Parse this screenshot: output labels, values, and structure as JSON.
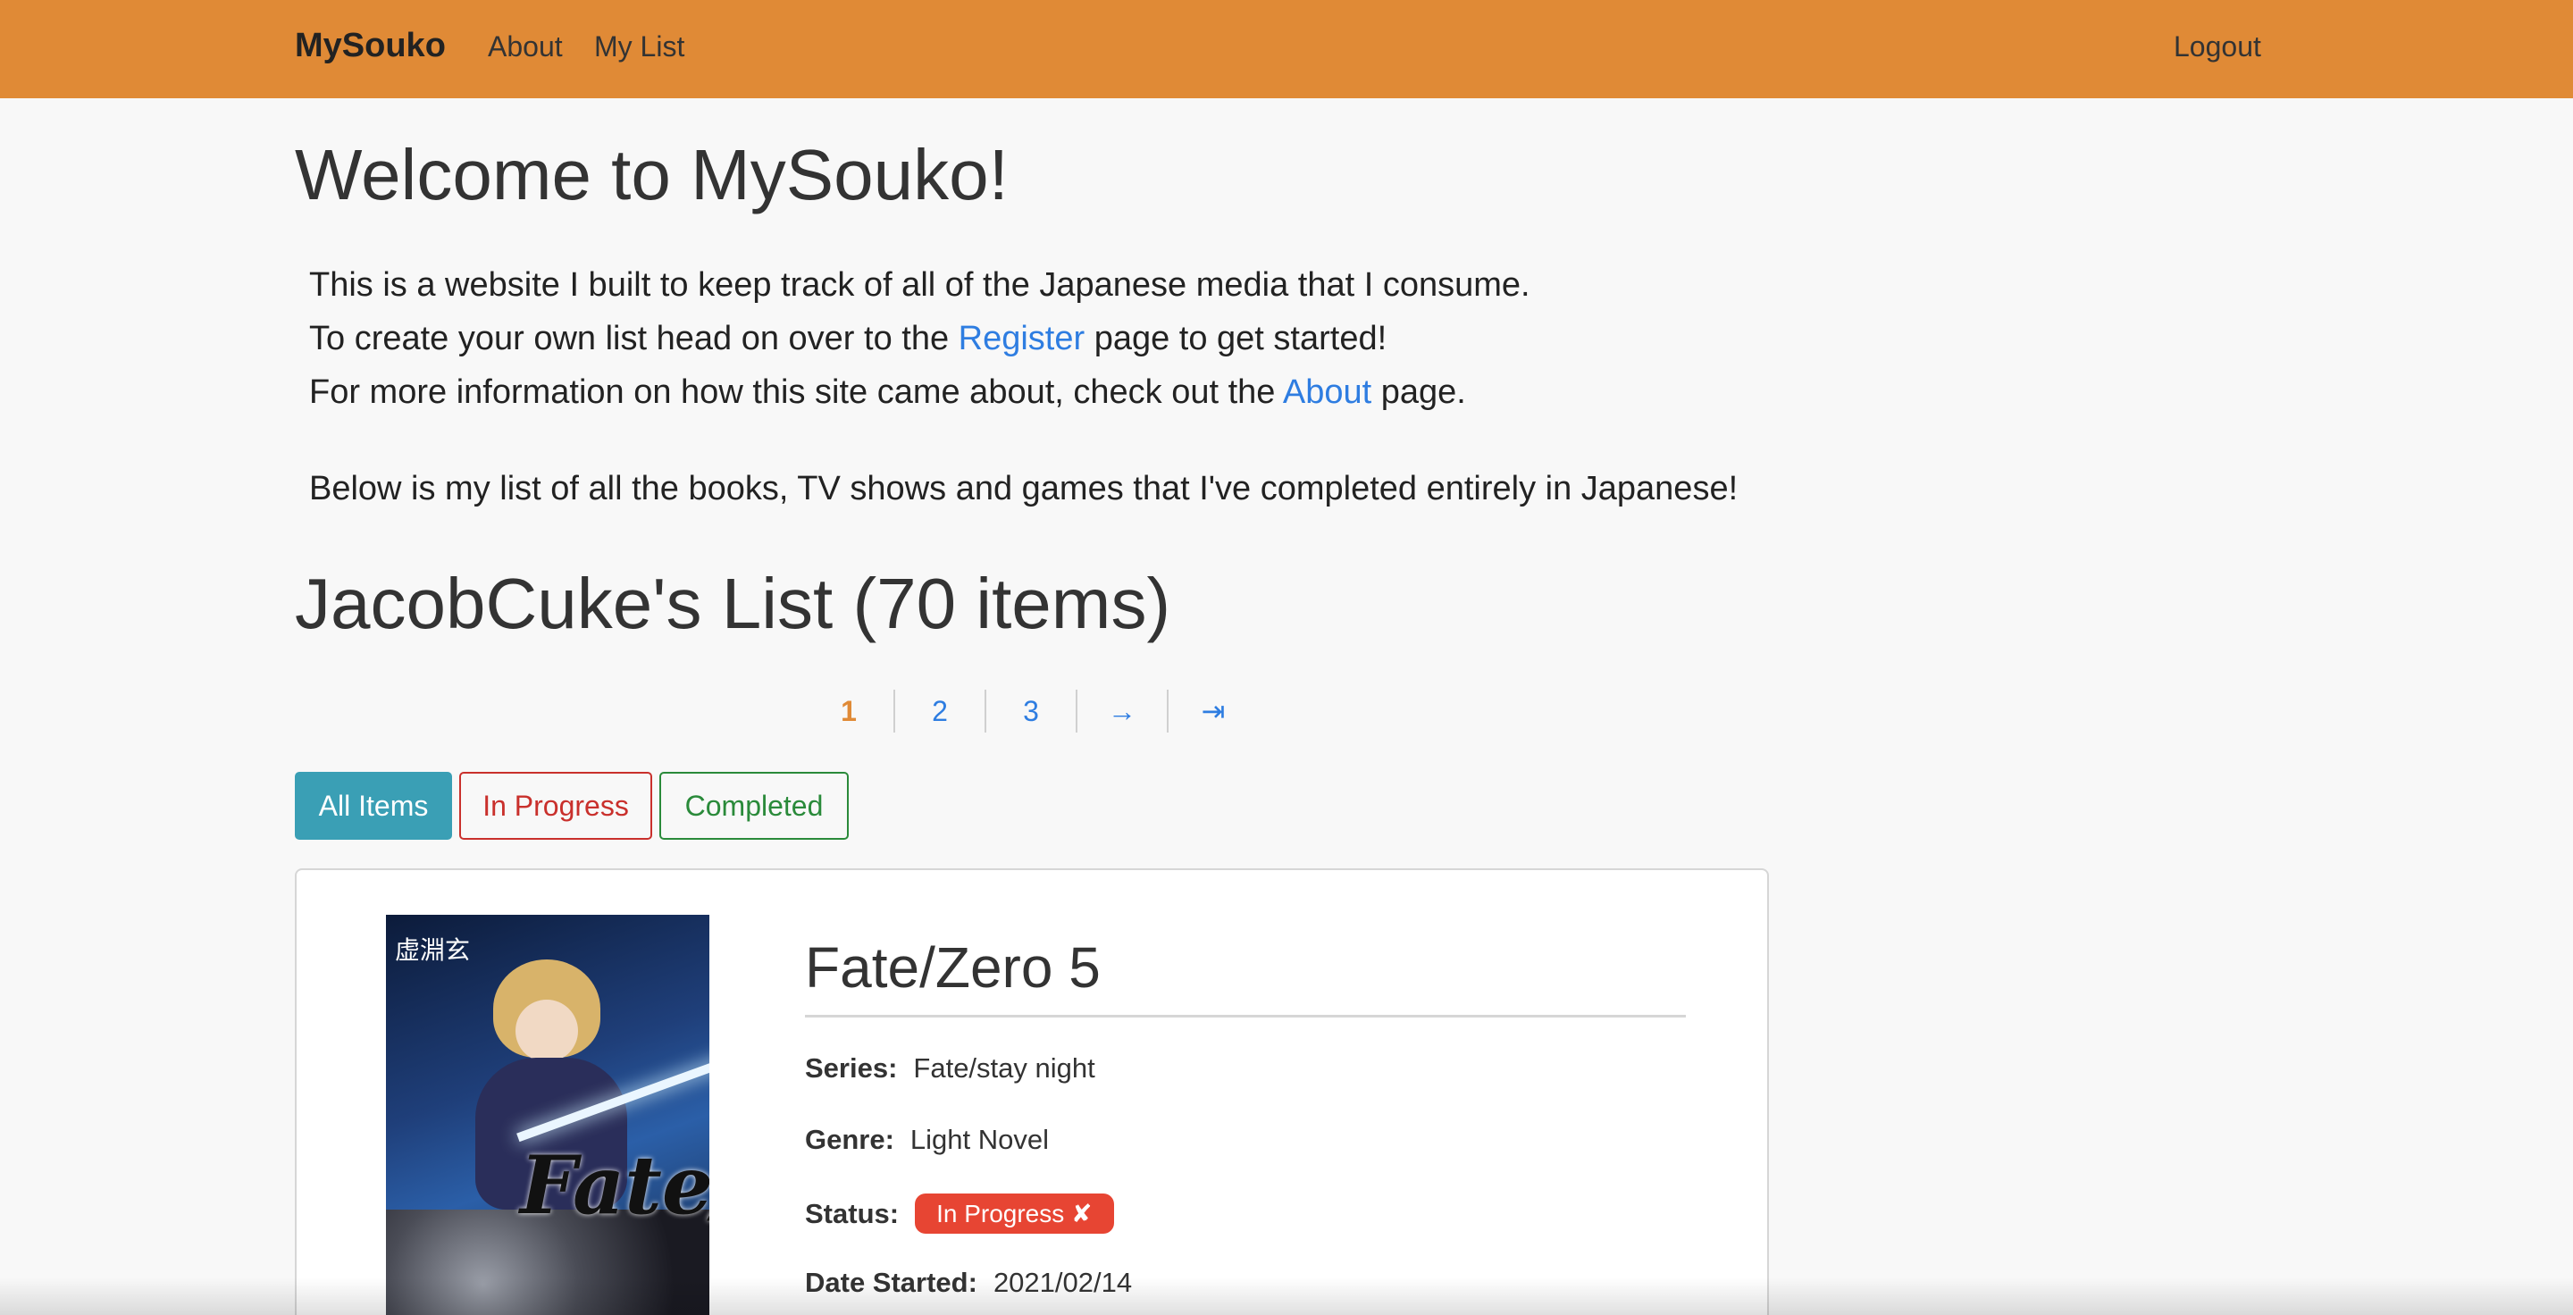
{
  "navbar": {
    "brand": "MySouko",
    "links": [
      "About",
      "My List"
    ],
    "logout": "Logout",
    "color": "#e08a36"
  },
  "welcome": {
    "title": "Welcome to MySouko!",
    "line1": "This is a website I built to keep track of all of the Japanese media that I consume.",
    "line2_pre": "To create your own list head on over to the ",
    "line2_link": "Register",
    "line2_post": " page to get started!",
    "line3_pre": "For more information on how this site came about, check out the ",
    "line3_link": "About",
    "line3_post": " page.",
    "line4": "Below is my list of all the books, TV shows and games that I've completed entirely in Japanese!"
  },
  "list": {
    "title": "JacobCuke's List (70 items)",
    "pagination": {
      "current": "1",
      "pages": [
        "2",
        "3"
      ],
      "next": "→",
      "last": "⇥"
    },
    "filters": {
      "all": "All Items",
      "in_progress": "In Progress",
      "completed": "Completed"
    },
    "item": {
      "cover_author": "虚淵玄",
      "cover_logo": "Fate/Zero",
      "title": "Fate/Zero 5",
      "series_label": "Series:",
      "series": "Fate/stay night",
      "genre_label": "Genre:",
      "genre": "Light Novel",
      "status_label": "Status:",
      "status": "In Progress ✘",
      "date_label": "Date Started:",
      "date": "2021/02/14"
    }
  },
  "colors": {
    "link": "#2e7de1",
    "all_items_button": "#3a9fb5",
    "in_progress": "#c9302c",
    "completed": "#2a8a3a",
    "status_badge": "#e74533"
  }
}
